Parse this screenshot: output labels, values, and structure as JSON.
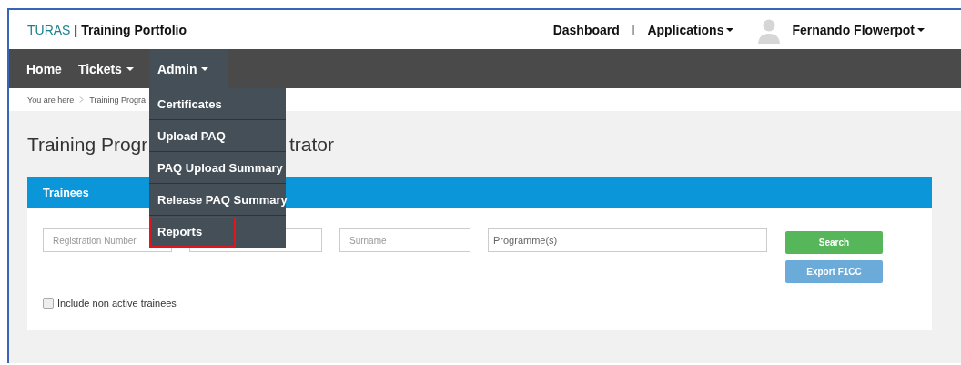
{
  "header": {
    "brand": "TURAS",
    "brand_separator": "|",
    "app_title": "Training Portfolio",
    "links": [
      {
        "label": "Dashboard",
        "dropdown": false
      },
      {
        "label": "Applications",
        "dropdown": true
      }
    ],
    "link_separator": "|",
    "user": {
      "name": "Fernando Flowerpot",
      "dropdown": true
    }
  },
  "nav": [
    {
      "label": "Home",
      "dropdown": false,
      "selected": false
    },
    {
      "label": "Tickets",
      "dropdown": true,
      "selected": false
    },
    {
      "label": "Admin",
      "dropdown": true,
      "selected": true,
      "menu": [
        {
          "label": "Certificates",
          "highlighted": false
        },
        {
          "label": "Upload PAQ",
          "highlighted": false
        },
        {
          "label": "PAQ Upload Summary",
          "highlighted": false
        },
        {
          "label": "Release PAQ Summary",
          "highlighted": false
        },
        {
          "label": "Reports",
          "highlighted": true
        }
      ]
    }
  ],
  "breadcrumb": [
    "You are here",
    "Training Progra"
  ],
  "page_title": {
    "start": "Training Progr",
    "end": "trator"
  },
  "panel": {
    "title": "Trainees",
    "fields": [
      {
        "kind": "text",
        "placeholder": "Registration Number"
      },
      {
        "kind": "text"
      },
      {
        "kind": "text",
        "placeholder": "Surname"
      },
      {
        "kind": "multiselect",
        "placeholder": "Programme(s)"
      }
    ],
    "buttons": [
      {
        "label": "Search",
        "kind": "success"
      },
      {
        "label": "Export F1CC",
        "kind": "info"
      }
    ],
    "checkbox": {
      "label": "Include non active trainees",
      "checked": false
    }
  }
}
